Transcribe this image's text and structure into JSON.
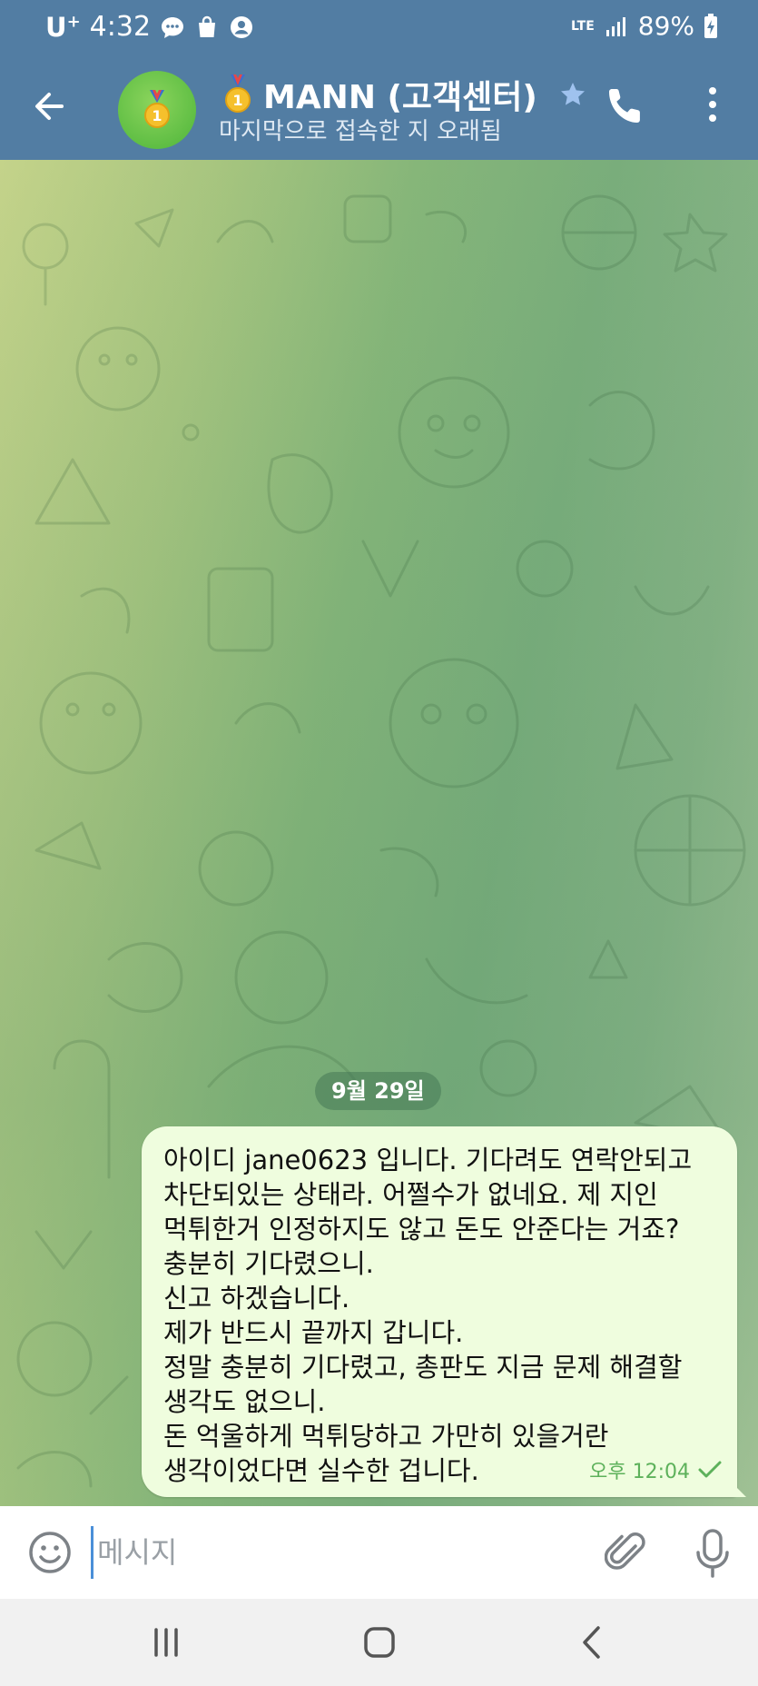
{
  "status_bar": {
    "carrier": "U",
    "carrier_sup": "+",
    "time": "4:32",
    "network": "LTE",
    "battery": "89%"
  },
  "header": {
    "title": "MANN (고객센터)",
    "subtitle": "마지막으로 접속한 지 오래됨"
  },
  "chat": {
    "date_label": "9월 29일",
    "messages": [
      {
        "lines": [
          "아이디 jane0623 입니다. 기다려도 연락안되고",
          "차단되있는 상태라. 어쩔수가 없네요. 제 지인",
          "먹튀한거 인정하지도 않고 돈도 안준다는 거죠?",
          "충분히 기다렸으니.",
          "신고 하겠습니다.",
          "제가 반드시 끝까지 갑니다.",
          "정말 충분히 기다렸고, 총판도 지금 문제 해결할",
          "생각도 없으니.",
          "돈 억울하게 먹튀당하고 가만히 있을거란",
          "생각이었다면 실수한 겁니다."
        ],
        "time": "오후 12:04",
        "status": "sent"
      }
    ]
  },
  "input": {
    "placeholder": "메시지"
  },
  "icons": {
    "back": "arrow-left-icon",
    "avatar": "gold-medal-icon",
    "verified": "star-icon",
    "call": "phone-icon",
    "more": "more-vertical-icon",
    "emoji": "smile-icon",
    "attach": "paperclip-icon",
    "mic": "microphone-icon"
  },
  "colors": {
    "header_bg": "#527da3",
    "bubble_bg": "#effdde",
    "time_green": "#5db15b"
  }
}
